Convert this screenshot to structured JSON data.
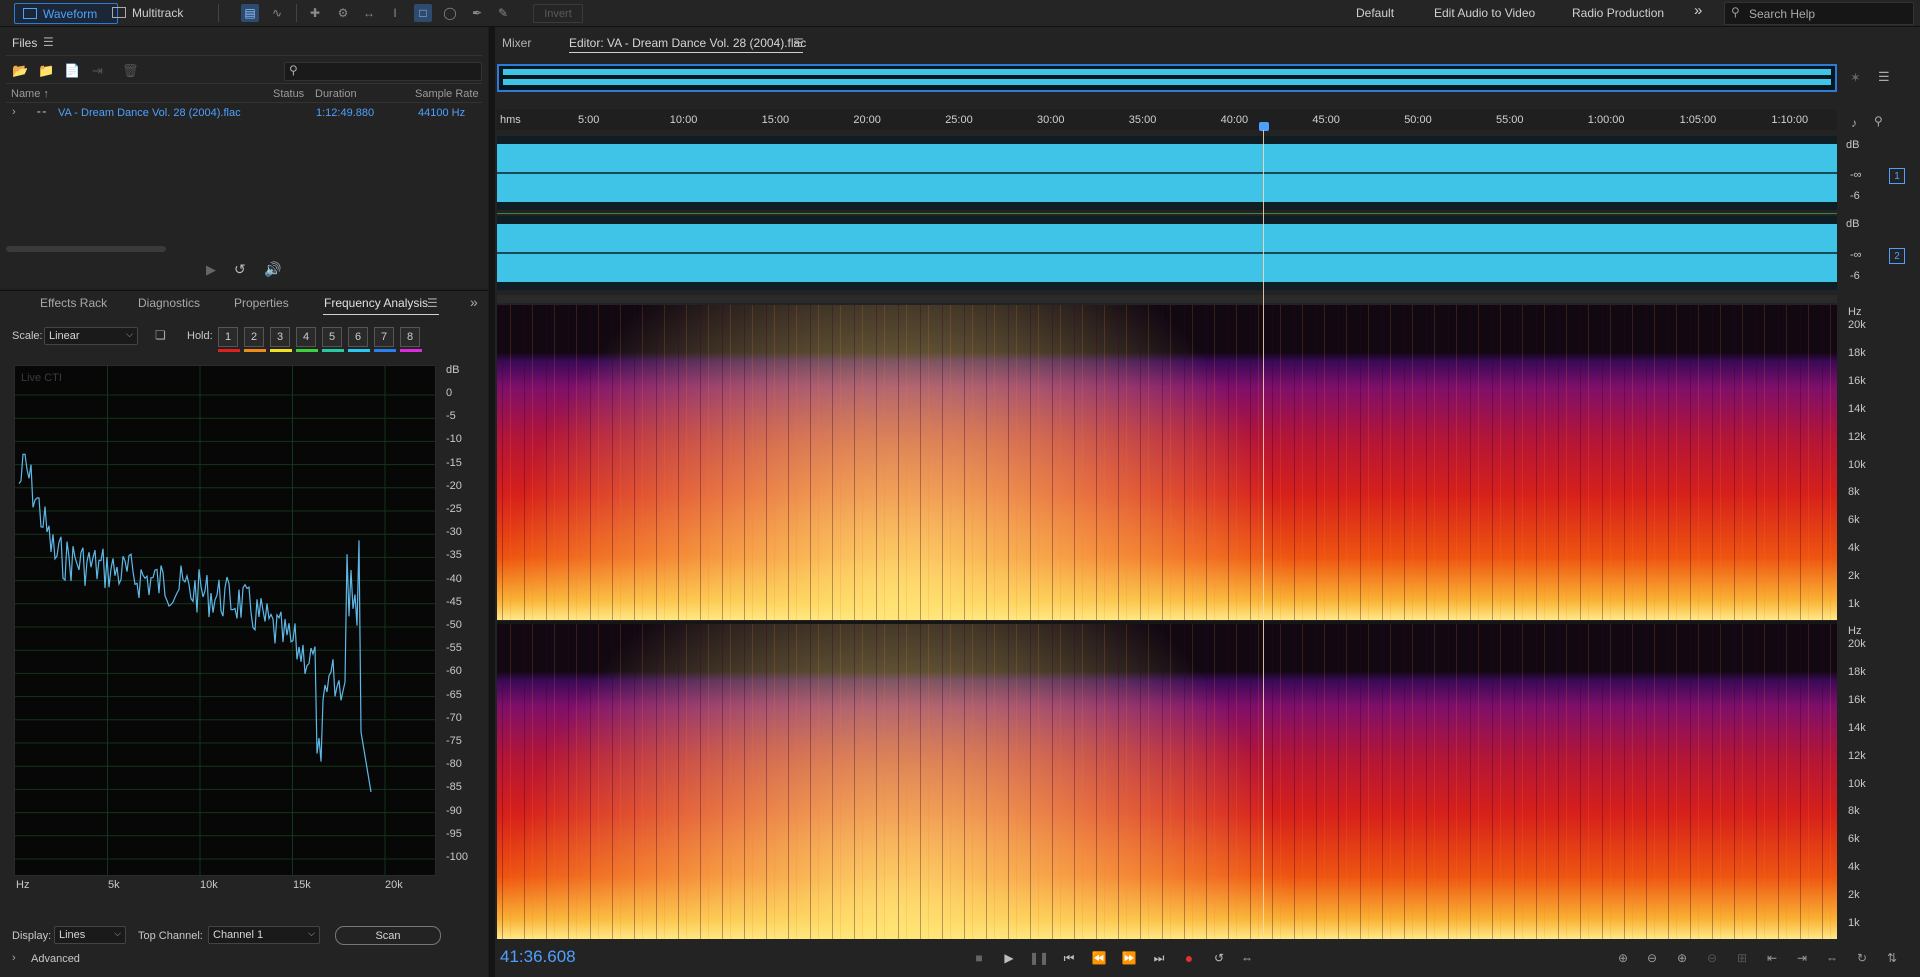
{
  "topbar": {
    "modes": [
      {
        "label": "Waveform",
        "active": true
      },
      {
        "label": "Multitrack",
        "active": false
      }
    ],
    "invert_label": "Invert",
    "workspaces": [
      "Default",
      "Edit Audio to Video",
      "Radio Production"
    ],
    "more_glyph": "»",
    "search_placeholder": "Search Help"
  },
  "files": {
    "title": "Files",
    "columns": {
      "name": "Name ↑",
      "status": "Status",
      "duration": "Duration",
      "sample_rate": "Sample Rate"
    },
    "items": [
      {
        "name": "VA - Dream Dance Vol. 28 (2004).flac",
        "status": "",
        "duration": "1:12:49.880",
        "sample_rate": "44100 Hz"
      }
    ]
  },
  "analysis": {
    "tabs": [
      "Effects Rack",
      "Diagnostics",
      "Properties",
      "Frequency Analysis"
    ],
    "active_tab": "Frequency Analysis",
    "scale_label": "Scale:",
    "scale_value": "Linear",
    "hold_label": "Hold:",
    "hold_buttons": [
      "1",
      "2",
      "3",
      "4",
      "5",
      "6",
      "7",
      "8"
    ],
    "hold_colors": [
      "#e02020",
      "#f08a18",
      "#f0e020",
      "#3cd23c",
      "#28c8a0",
      "#28c8f0",
      "#2880f0",
      "#e028e0"
    ],
    "graph_overlay": "Live CTI",
    "db_unit": "dB",
    "db_ticks": [
      "0",
      "-5",
      "-10",
      "-15",
      "-20",
      "-25",
      "-30",
      "-35",
      "-40",
      "-45",
      "-50",
      "-55",
      "-60",
      "-65",
      "-70",
      "-75",
      "-80",
      "-85",
      "-90",
      "-95",
      "-100"
    ],
    "hz_ticks": [
      "Hz",
      "5k",
      "10k",
      "15k",
      "20k"
    ],
    "display_label": "Display:",
    "display_value": "Lines",
    "top_channel_label": "Top Channel:",
    "top_channel_value": "Channel 1",
    "scan_label": "Scan",
    "advanced_label": "Advanced",
    "curve_color": "#5fb8e6"
  },
  "editor": {
    "mixer_tab": "Mixer",
    "editor_tab": "Editor: VA - Dream Dance Vol. 28 (2004).flac",
    "ruler_unit": "hms",
    "ruler_labels": [
      "5:00",
      "10:00",
      "15:00",
      "20:00",
      "25:00",
      "30:00",
      "35:00",
      "40:00",
      "45:00",
      "50:00",
      "55:00",
      "1:00:00",
      "1:05:00",
      "1:10:00"
    ],
    "waveform_color": "#3fc4e8",
    "channel1": {
      "unit": "dB",
      "ticks": [
        "-∞",
        "-6"
      ],
      "badge": "1"
    },
    "channel2": {
      "unit": "dB",
      "ticks": [
        "-∞",
        "-6"
      ],
      "badge": "2"
    },
    "spectral_unit": "Hz",
    "spectral_ticks": [
      "20k",
      "18k",
      "16k",
      "14k",
      "12k",
      "10k",
      "8k",
      "6k",
      "4k",
      "2k",
      "1k"
    ],
    "playhead_time": "41:36.608"
  }
}
